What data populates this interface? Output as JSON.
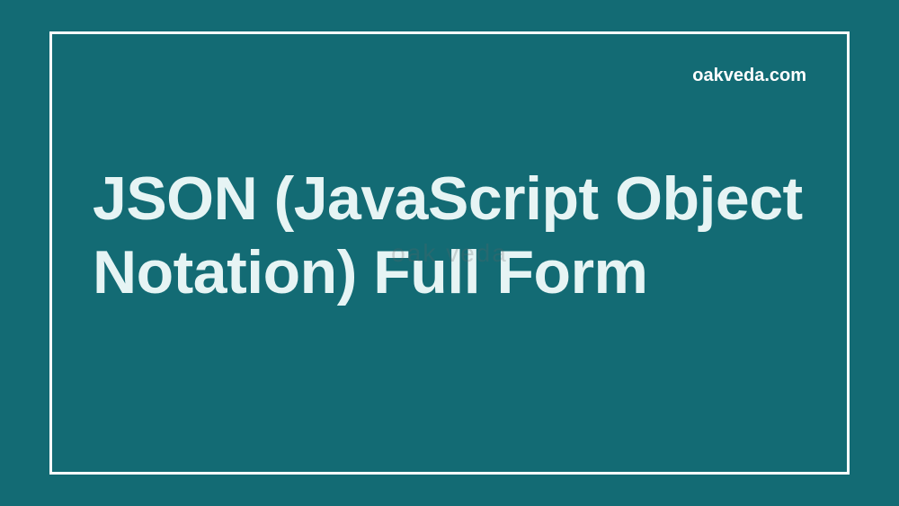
{
  "website": "oakveda.com",
  "title": "JSON (JavaScript Object Notation) Full Form",
  "watermark": "oak veda"
}
